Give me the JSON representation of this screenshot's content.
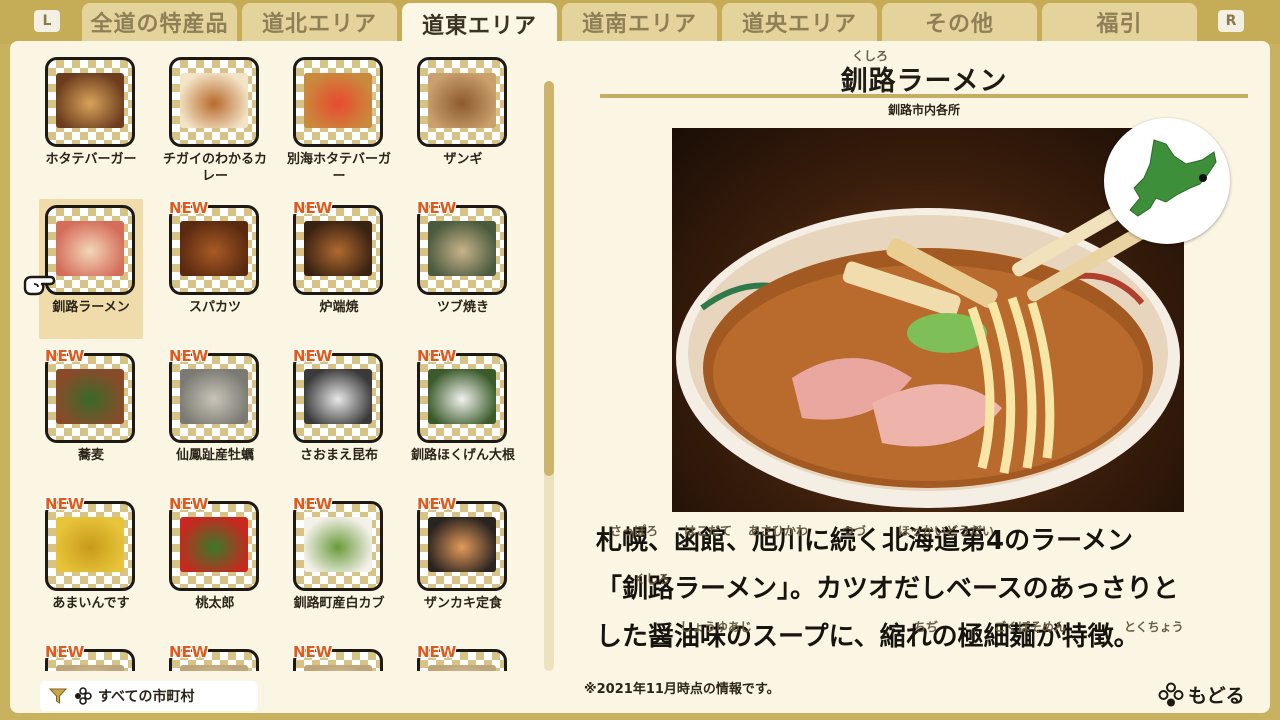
{
  "tabs": {
    "left_button": "L",
    "right_button": "R",
    "items": [
      {
        "label": "全道の特産品"
      },
      {
        "label": "道北エリア"
      },
      {
        "label": "道東エリア"
      },
      {
        "label": "道南エリア"
      },
      {
        "label": "道央エリア"
      },
      {
        "label": "その他"
      },
      {
        "label": "福引"
      }
    ],
    "active": "道東エリア"
  },
  "grid": {
    "new_badge": "NEW",
    "selected": "釧路ラーメン",
    "items": [
      {
        "label": "ホタテバーガー",
        "new": false,
        "icon": "scallop-burger-photo"
      },
      {
        "label": "チガイのわかるカレー",
        "new": false,
        "icon": "curry-photo"
      },
      {
        "label": "別海ホタテバーガー",
        "new": false,
        "icon": "betsukai-burger-photo"
      },
      {
        "label": "ザンギ",
        "new": false,
        "icon": "zangi-photo"
      },
      {
        "label": "釧路ラーメン",
        "new": false,
        "icon": "ramen-photo"
      },
      {
        "label": "スパカツ",
        "new": true,
        "icon": "spakatsu-photo"
      },
      {
        "label": "炉端焼",
        "new": true,
        "icon": "robatayaki-photo"
      },
      {
        "label": "ツブ焼き",
        "new": true,
        "icon": "tsubu-photo"
      },
      {
        "label": "蕎麦",
        "new": true,
        "icon": "soba-photo"
      },
      {
        "label": "仙鳳趾産牡蠣",
        "new": true,
        "icon": "oyster-photo"
      },
      {
        "label": "さおまえ昆布",
        "new": true,
        "icon": "kombu-photo"
      },
      {
        "label": "釧路ほくげん大根",
        "new": true,
        "icon": "daikon-photo"
      },
      {
        "label": "あまいんです",
        "new": true,
        "icon": "corn-photo"
      },
      {
        "label": "桃太郎",
        "new": true,
        "icon": "tomato-photo"
      },
      {
        "label": "釧路町産白カブ",
        "new": true,
        "icon": "turnip-photo"
      },
      {
        "label": "ザンカキ定食",
        "new": true,
        "icon": "set-meal-photo"
      },
      {
        "label": "",
        "new": true,
        "icon": "item-photo"
      },
      {
        "label": "",
        "new": true,
        "icon": "item-photo"
      },
      {
        "label": "",
        "new": true,
        "icon": "item-photo"
      },
      {
        "label": "",
        "new": true,
        "icon": "item-photo"
      }
    ]
  },
  "filter": {
    "label": "すべての市町村",
    "icon": "filter-icon"
  },
  "detail": {
    "title": "釧路ラーメン",
    "title_ruby": "くしろ",
    "location": "釧路市内各所",
    "description_lines": [
      "札幌、函館、旭川に続く北海道第4のラーメン",
      "「釧路ラーメン」。カツオだしベースのあっさりと",
      "した醤油味のスープに、縮れの極細麺が特徴。"
    ],
    "description_ruby": [
      [
        "さっぽろ",
        "はこだて",
        "あさひかわ",
        "つづ",
        "ほっかいどうだい"
      ],
      [
        "くしろ"
      ],
      [
        "しょうゆあじ",
        "ちぢ",
        "ごくぼそめん",
        "とくちょう"
      ]
    ],
    "note": "※2021年11月時点の情報です。"
  },
  "footer": {
    "back_label": "もどる",
    "back_icon": "b-button-icon"
  },
  "colors": {
    "frame": "#c9b25f",
    "panel": "#faf6e3",
    "new_badge": "#e05a1a",
    "tab_active": "#fbf7e4",
    "tab_inactive": "#e4d39a"
  }
}
